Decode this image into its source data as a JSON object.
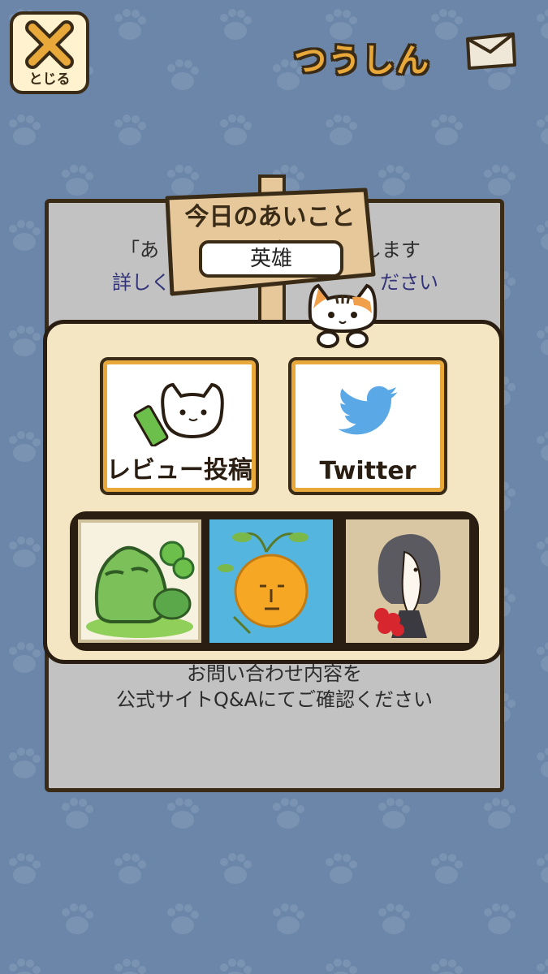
{
  "header": {
    "close_icon": "x-icon",
    "close_label": "とじる",
    "title": "つうしん",
    "envelope_icon": "envelope-icon"
  },
  "panel": {
    "line1_left": "「あ",
    "line1_right": "します",
    "line2_left": "詳しく",
    "line2_right": "ださい",
    "line3": "お問い合わせ内容を",
    "line4": "公式サイトQ&Aにてご確認ください"
  },
  "sign": {
    "title": "今日のあいことば",
    "word": "英雄"
  },
  "actions": [
    {
      "label": "レビュー投稿",
      "icon": "cat-pencil-icon"
    },
    {
      "label": "Twitter",
      "icon": "twitter-bird-icon"
    }
  ],
  "apps": [
    {
      "icon": "frog-app-icon"
    },
    {
      "icon": "orange-face-app-icon"
    },
    {
      "icon": "ghost-girl-app-icon"
    }
  ],
  "colors": {
    "background": "#6b86a8",
    "accent": "#e8a83a",
    "outline": "#3a2b17",
    "twitter": "#5aa9e6"
  }
}
